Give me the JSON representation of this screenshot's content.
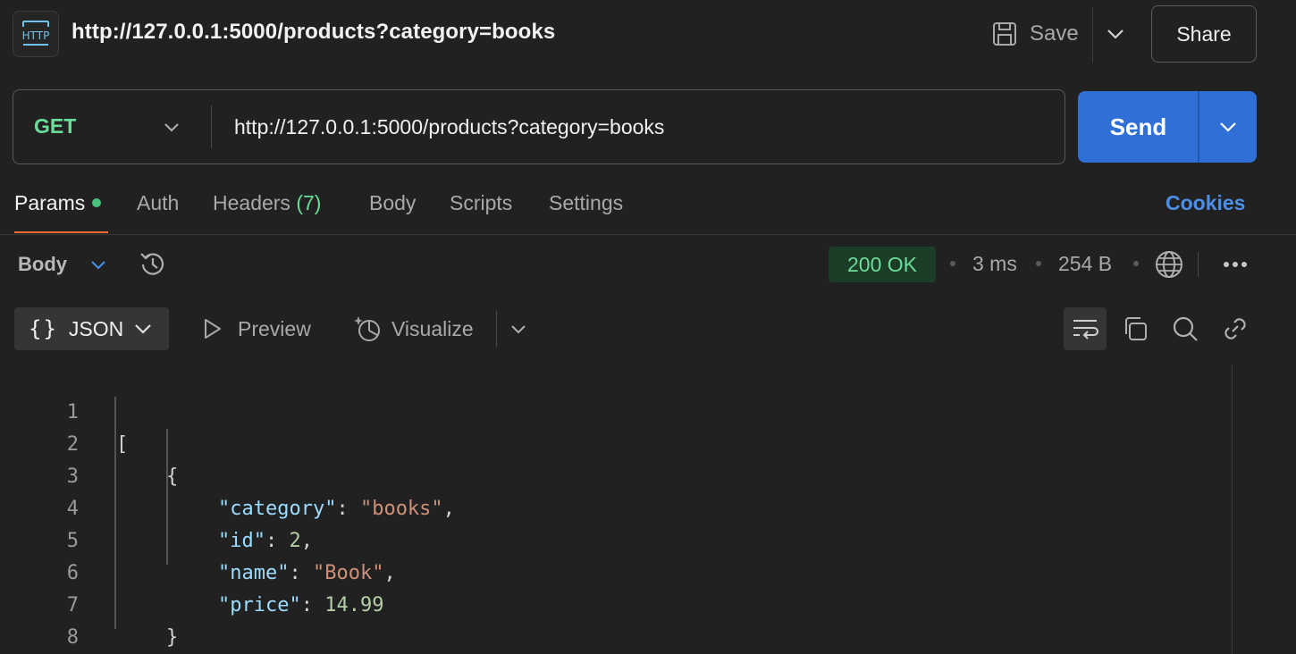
{
  "request": {
    "title": "http://127.0.0.1:5000/products?category=books",
    "method": "GET",
    "url": "http://127.0.0.1:5000/products?category=books",
    "save_label": "Save",
    "share_label": "Share",
    "send_label": "Send"
  },
  "tabs": [
    {
      "label": "Params",
      "active": true
    },
    {
      "label": "Auth"
    },
    {
      "label": "Headers",
      "count": "(7)"
    },
    {
      "label": "Body"
    },
    {
      "label": "Scripts"
    },
    {
      "label": "Settings"
    }
  ],
  "cookies_label": "Cookies",
  "response": {
    "body_label": "Body",
    "status": "200 OK",
    "time": "3 ms",
    "size": "254 B",
    "format": "JSON",
    "preview_label": "Preview",
    "visualize_label": "Visualize"
  },
  "code": {
    "lines": [
      {
        "n": "1",
        "t": "["
      },
      {
        "n": "2",
        "t": "{"
      },
      {
        "n": "3",
        "key": "\"category\"",
        "sep": ": ",
        "val": "\"books\"",
        "end": ","
      },
      {
        "n": "4",
        "key": "\"id\"",
        "sep": ": ",
        "val": "2",
        "end": ","
      },
      {
        "n": "5",
        "key": "\"name\"",
        "sep": ": ",
        "val": "\"Book\"",
        "end": ","
      },
      {
        "n": "6",
        "key": "\"price\"",
        "sep": ": ",
        "val": "14.99",
        "end": ""
      },
      {
        "n": "7",
        "t": "}"
      },
      {
        "n": "8",
        "t": "]"
      }
    ]
  },
  "colors": {
    "accent_tab": "#ff6c37",
    "send": "#2f6fd6",
    "method_get": "#6bdd9a",
    "link": "#4c8fe8"
  },
  "icons": [
    "http-icon",
    "save-icon",
    "chevron-down-icon",
    "history-icon",
    "globe-icon",
    "more-icon",
    "braces-icon",
    "play-icon",
    "visualize-icon",
    "wrap-icon",
    "copy-icon",
    "search-icon",
    "link-icon"
  ]
}
